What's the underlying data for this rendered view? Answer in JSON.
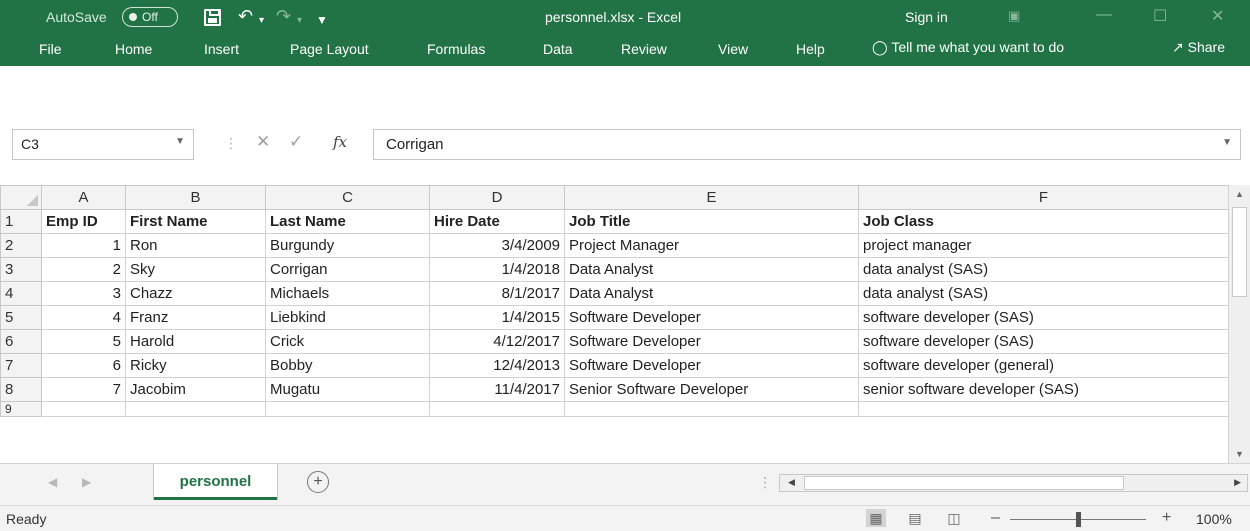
{
  "titlebar": {
    "autosave_label": "AutoSave",
    "autosave_state": "Off",
    "window_title": "personnel.xlsx  -  Excel",
    "signin_label": "Sign in"
  },
  "menu": {
    "items": [
      "File",
      "Home",
      "Insert",
      "Page Layout",
      "Formulas",
      "Data",
      "Review",
      "View",
      "Help"
    ],
    "tell_me": "Tell me what you want to do",
    "share": "Share"
  },
  "formula_bar": {
    "name_box": "C3",
    "fx_label": "fx",
    "value": "Corrigan"
  },
  "grid": {
    "columns": [
      "A",
      "B",
      "C",
      "D",
      "E",
      "F"
    ],
    "row_numbers": [
      "1",
      "2",
      "3",
      "4",
      "5",
      "6",
      "7",
      "8",
      "9"
    ],
    "header_row": [
      "Emp ID",
      "First Name",
      "Last Name",
      "Hire Date",
      "Job Title",
      "Job Class"
    ],
    "rows": [
      [
        "1",
        "Ron",
        "Burgundy",
        "3/4/2009",
        "Project Manager",
        "project manager"
      ],
      [
        "2",
        "Sky",
        "Corrigan",
        "1/4/2018",
        "Data Analyst",
        "data analyst (SAS)"
      ],
      [
        "3",
        "Chazz",
        "Michaels",
        "8/1/2017",
        "Data Analyst",
        "data analyst (SAS)"
      ],
      [
        "4",
        "Franz",
        "Liebkind",
        "1/4/2015",
        "Software Developer",
        "software developer (SAS)"
      ],
      [
        "5",
        "Harold",
        "Crick",
        "4/12/2017",
        "Software Developer",
        "software developer (SAS)"
      ],
      [
        "6",
        "Ricky",
        "Bobby",
        "12/4/2013",
        "Software Developer",
        "software developer (general)"
      ],
      [
        "7",
        "Jacobim",
        "Mugatu",
        "11/4/2017",
        "Senior Software Developer",
        "senior software developer (SAS)"
      ]
    ],
    "selected_cell": "C3"
  },
  "sheets": {
    "active_tab": "personnel"
  },
  "status": {
    "mode": "Ready",
    "zoom": "100%"
  },
  "colors": {
    "brand": "#217346"
  }
}
